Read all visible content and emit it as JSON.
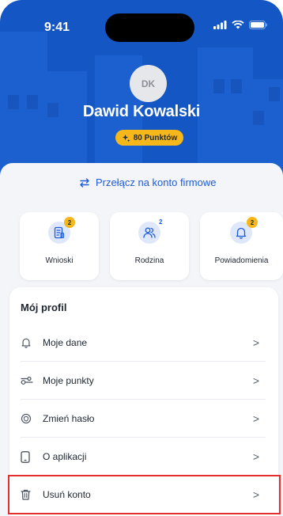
{
  "status_bar": {
    "time": "9:41",
    "icons": [
      "signal-icon",
      "wifi-icon",
      "battery-icon"
    ]
  },
  "profile": {
    "initials": "DK",
    "name": "Dawid Kowalski",
    "points_label": "80 Punktów",
    "points_icon": "sparkle-icon"
  },
  "switch_account": {
    "label": "Przełącz na konto firmowe",
    "icon": "swap-arrows-icon"
  },
  "quick_cards": [
    {
      "label": "Wnioski",
      "badge": "2",
      "icon": "document-icon"
    },
    {
      "label": "Rodzina",
      "badge": "2",
      "icon": "people-icon"
    },
    {
      "label": "Powiadomienia",
      "badge": "2",
      "icon": "bell-icon"
    }
  ],
  "profile_section": {
    "title": "Mój profil",
    "items": [
      {
        "label": "Moje dane",
        "icon": "bell-outline-icon"
      },
      {
        "label": "Moje punkty",
        "icon": "points-icon"
      },
      {
        "label": "Zmień hasło",
        "icon": "shield-icon"
      },
      {
        "label": "O aplikacji",
        "icon": "phone-icon"
      },
      {
        "label": "Usuń konto",
        "icon": "trash-icon"
      }
    ],
    "chevron": ">"
  },
  "colors": {
    "header_blue": "#1457c4",
    "accent_blue": "#1e5bd6",
    "badge_yellow": "#f6b71a",
    "highlight_red": "#e23030"
  }
}
